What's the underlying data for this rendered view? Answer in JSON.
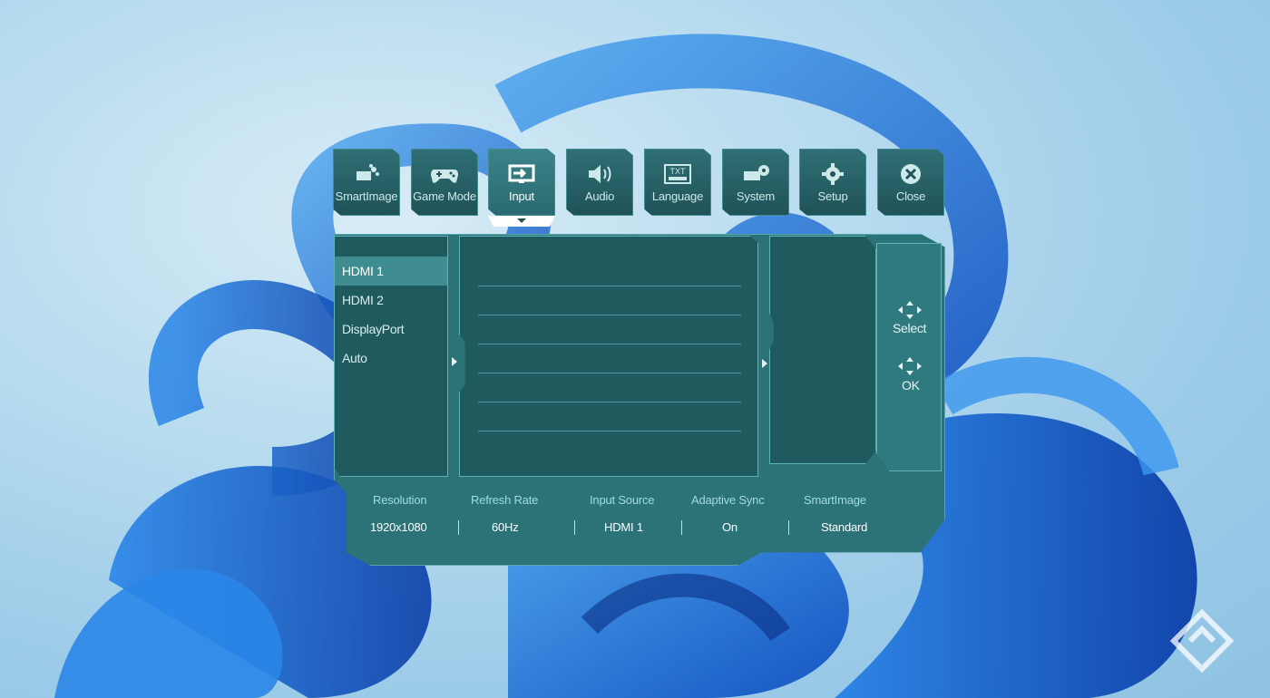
{
  "tabs": [
    {
      "label": "SmartImage",
      "icon": "smartimage-icon"
    },
    {
      "label": "Game Mode",
      "icon": "gamepad-icon"
    },
    {
      "label": "Input",
      "icon": "input-source-icon",
      "active": true
    },
    {
      "label": "Audio",
      "icon": "speaker-icon"
    },
    {
      "label": "Language",
      "icon": "txt-language-icon"
    },
    {
      "label": "System",
      "icon": "system-gear-icon"
    },
    {
      "label": "Setup",
      "icon": "setup-gear-icon"
    },
    {
      "label": "Close",
      "icon": "close-icon"
    }
  ],
  "input_list": {
    "items": [
      {
        "label": "HDMI 1",
        "selected": true
      },
      {
        "label": "HDMI 2"
      },
      {
        "label": "DisplayPort"
      },
      {
        "label": "Auto"
      }
    ]
  },
  "nav": {
    "select_label": "Select",
    "ok_label": "OK"
  },
  "status": {
    "headers": [
      "Resolution",
      "Refresh Rate",
      "Input Source",
      "Adaptive Sync",
      "SmartImage"
    ],
    "values": [
      "1920x1080",
      "60Hz",
      "HDMI 1",
      "On",
      "Standard"
    ]
  },
  "colors": {
    "panel": "#1f5a5f",
    "frame": "#2c7378",
    "border": "#5fb2b6",
    "selected": "#3f8c91",
    "wallpaper_blue": "#1f73d6"
  }
}
